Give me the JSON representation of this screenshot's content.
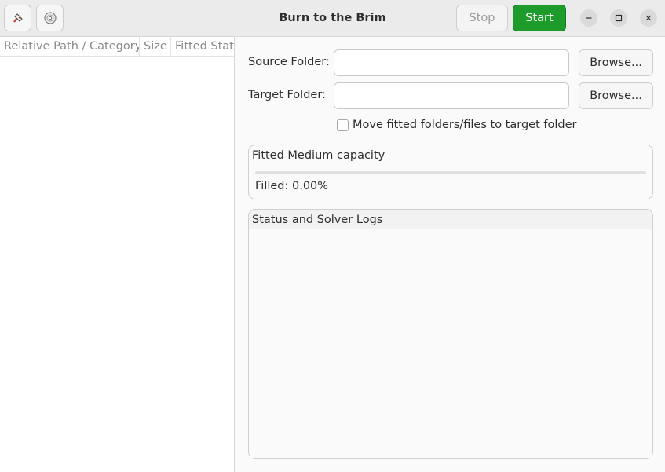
{
  "window": {
    "title": "Burn to the Brim",
    "stop_label": "Stop",
    "start_label": "Start",
    "start_color": "#1d9c2c"
  },
  "toolbar": {
    "left_icons": [
      "broom-icon",
      "disc-icon"
    ]
  },
  "table": {
    "columns": [
      "Relative Path / Category",
      "Size",
      "Fitted Status"
    ],
    "rows": []
  },
  "form": {
    "source_label": "Source Folder:",
    "source_value": "",
    "target_label": "Target Folder:",
    "target_value": "",
    "browse_label": "Browse...",
    "move_checkbox_label": "Move fitted folders/files to target folder",
    "move_checked": false
  },
  "capacity": {
    "title": "Fitted Medium capacity",
    "filled_text": "Filled: 0.00%",
    "filled_fraction": 0.0
  },
  "logs": {
    "title": "Status and Solver Logs",
    "content": ""
  }
}
